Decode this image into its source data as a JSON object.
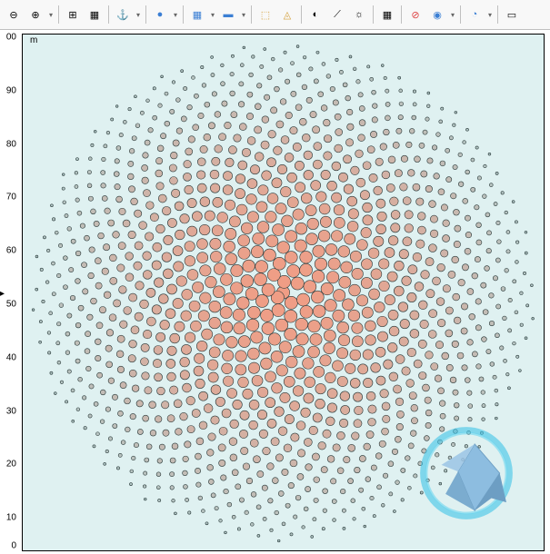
{
  "toolbar": {
    "tools": [
      {
        "name": "zoom-out-icon",
        "glyph": "⊖",
        "drop": false
      },
      {
        "name": "zoom-in-icon",
        "glyph": "⊕",
        "drop": true
      },
      {
        "sep": true
      },
      {
        "name": "zoom-extents-icon",
        "glyph": "⊞",
        "drop": false
      },
      {
        "name": "zoom-selected-icon",
        "glyph": "▦",
        "drop": false
      },
      {
        "sep": true
      },
      {
        "name": "anchor-icon",
        "glyph": "⚓",
        "drop": true
      },
      {
        "sep": true
      },
      {
        "name": "point-style-icon",
        "glyph": "●",
        "color": "#3b7fd4",
        "drop": true
      },
      {
        "sep": true
      },
      {
        "name": "mesh-icon",
        "glyph": "▦",
        "color": "#3b7fd4",
        "drop": true
      },
      {
        "name": "surface-icon",
        "glyph": "▬",
        "color": "#3b7fd4",
        "drop": true
      },
      {
        "sep": true
      },
      {
        "name": "select-box-icon",
        "glyph": "⬚",
        "color": "#d4a03b",
        "drop": false
      },
      {
        "name": "select-lasso-icon",
        "glyph": "◬",
        "color": "#d4a03b",
        "drop": false
      },
      {
        "sep": true
      },
      {
        "name": "transparency-icon",
        "glyph": "◐",
        "drop": false
      },
      {
        "name": "wireframe-icon",
        "glyph": "⟋",
        "drop": false
      },
      {
        "name": "lighting-icon",
        "glyph": "☼",
        "drop": false
      },
      {
        "sep": true
      },
      {
        "name": "grid-icon",
        "glyph": "▦",
        "drop": false
      },
      {
        "sep": true
      },
      {
        "name": "hide-icon",
        "glyph": "⊘",
        "color": "#d44",
        "drop": false
      },
      {
        "name": "show-icon",
        "glyph": "◉",
        "color": "#3b7fd4",
        "drop": true
      },
      {
        "sep": true
      },
      {
        "name": "camera-icon",
        "glyph": "◔",
        "color": "#3b7fd4",
        "drop": true
      },
      {
        "sep": true
      },
      {
        "name": "image-icon",
        "glyph": "▭",
        "drop": false
      }
    ]
  },
  "axes": {
    "unit": "m",
    "yticks": [
      {
        "v": "00",
        "pos": 0.0
      },
      {
        "v": "90",
        "pos": 0.105
      },
      {
        "v": "80",
        "pos": 0.21
      },
      {
        "v": "70",
        "pos": 0.315
      },
      {
        "v": "60",
        "pos": 0.42
      },
      {
        "v": "50",
        "pos": 0.525
      },
      {
        "v": "40",
        "pos": 0.63
      },
      {
        "v": "30",
        "pos": 0.735
      },
      {
        "v": "20",
        "pos": 0.84
      },
      {
        "v": "10",
        "pos": 0.945
      },
      {
        "v": "0",
        "pos": 1.0
      }
    ]
  },
  "scatter": {
    "grid": 34,
    "center_radius": 7,
    "edge_radius": 1.3,
    "fill_center": "#f09d85",
    "fill_edge": "#b0c8c8",
    "stroke": "#2a3a3a"
  },
  "logo": {
    "ring_color": "#3ec4e8",
    "diamond_color": "#6aa8d8"
  }
}
